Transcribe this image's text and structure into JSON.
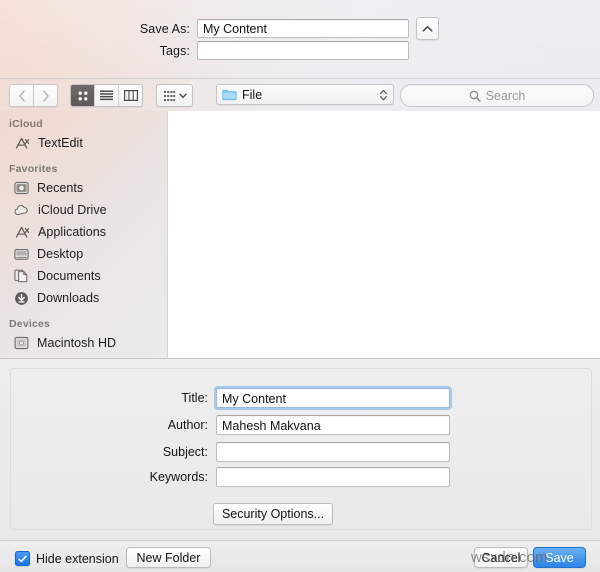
{
  "header": {
    "save_as_label": "Save As:",
    "save_as_value": "My Content",
    "tags_label": "Tags:",
    "tags_value": "",
    "disclosure_icon": "chevron-up-icon"
  },
  "toolbar": {
    "back_icon": "chevron-left-icon",
    "forward_icon": "chevron-right-icon",
    "view_icon_grid": "icon-view-icon",
    "view_icon_list": "list-view-icon",
    "view_icon_column": "column-view-icon",
    "arrange_icon": "arrange-grid-icon",
    "arrange_chevron": "chevron-down-icon",
    "path_label": "File",
    "path_folder_icon": "folder-icon",
    "path_stepper_icon": "up-down-chevron-icon",
    "search_icon": "search-icon",
    "search_placeholder": "Search",
    "search_value": ""
  },
  "sidebar": {
    "sections": [
      {
        "title": "iCloud",
        "items": [
          {
            "label": "TextEdit",
            "icon": "applications-icon"
          }
        ]
      },
      {
        "title": "Favorites",
        "items": [
          {
            "label": "Recents",
            "icon": "recents-clock-icon"
          },
          {
            "label": "iCloud Drive",
            "icon": "cloud-icon"
          },
          {
            "label": "Applications",
            "icon": "applications-icon"
          },
          {
            "label": "Desktop",
            "icon": "desktop-monitor-icon"
          },
          {
            "label": "Documents",
            "icon": "documents-pages-icon"
          },
          {
            "label": "Downloads",
            "icon": "downloads-arrow-icon"
          }
        ]
      },
      {
        "title": "Devices",
        "items": [
          {
            "label": "Macintosh HD",
            "icon": "hard-drive-icon"
          }
        ]
      }
    ]
  },
  "form": {
    "fields": [
      {
        "label": "Title:",
        "value": "My Content",
        "focused": true
      },
      {
        "label": "Author:",
        "value": "Mahesh Makvana",
        "focused": false
      },
      {
        "label": "Subject:",
        "value": "",
        "focused": false
      },
      {
        "label": "Keywords:",
        "value": "",
        "focused": false
      }
    ],
    "security_button": "Security Options..."
  },
  "footer": {
    "hide_extension_label": "Hide extension",
    "hide_extension_checked": true,
    "check_icon": "checkmark-icon",
    "new_folder_label": "New Folder",
    "cancel_label": "Cancel",
    "save_label": "Save"
  },
  "watermark": {
    "text": "wsxdn.com"
  },
  "colors": {
    "accent_blue": "#2b82e6",
    "focus_ring": "#70aae2",
    "folder_blue": "#6fc6f5",
    "selected_segment": "#5d5957"
  }
}
